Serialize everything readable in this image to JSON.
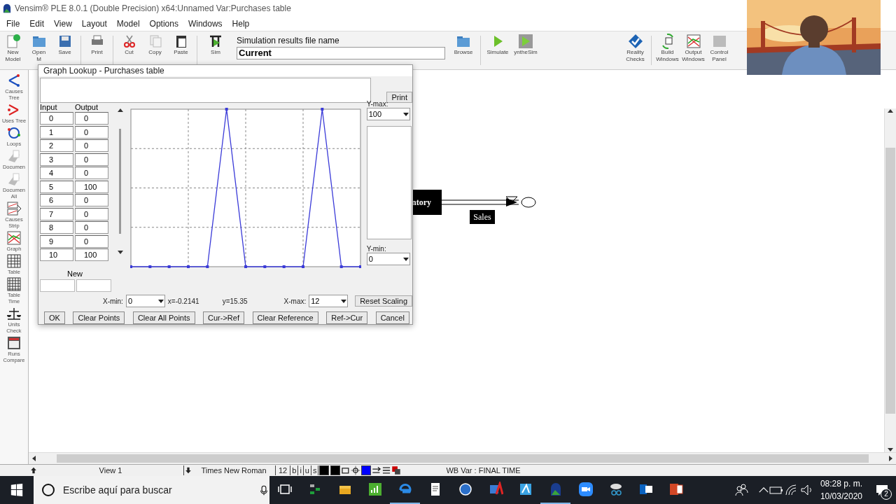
{
  "window": {
    "title": "Vensim® PLE 8.0.1 (Double Precision) x64:Unnamed Var:Purchases table"
  },
  "menu": [
    "File",
    "Edit",
    "View",
    "Layout",
    "Model",
    "Options",
    "Windows",
    "Help"
  ],
  "toolbar": {
    "left": [
      {
        "lines": [
          "New",
          "Model"
        ]
      },
      {
        "lines": [
          "Open",
          "M"
        ]
      },
      {
        "lines": [
          "Save"
        ]
      },
      {
        "lines": [
          "Print"
        ]
      },
      {
        "lines": [
          "Cut"
        ]
      },
      {
        "lines": [
          "Copy"
        ]
      },
      {
        "lines": [
          "Paste"
        ]
      },
      {
        "lines": [
          "Sim"
        ]
      }
    ],
    "results_file": {
      "label": "Simulation results file name",
      "value": "Current"
    },
    "right": [
      {
        "lines": [
          "Browse"
        ]
      },
      {
        "lines": [
          "Simulate"
        ]
      },
      {
        "lines": [
          "yntheSim"
        ]
      },
      {
        "lines": [
          "Reality",
          "Checks"
        ]
      },
      {
        "lines": [
          "Build",
          "Windows"
        ]
      },
      {
        "lines": [
          "Output",
          "Windows"
        ]
      },
      {
        "lines": [
          "Control",
          "Panel"
        ]
      }
    ]
  },
  "sidebar": {
    "items": [
      {
        "lines": [
          "Causes",
          "Tree"
        ]
      },
      {
        "lines": [
          "Uses Tree"
        ]
      },
      {
        "lines": [
          "Loops"
        ]
      },
      {
        "lines": [
          "Documen"
        ]
      },
      {
        "lines": [
          "Documen",
          "All"
        ]
      },
      {
        "lines": [
          "Causes",
          "Strip"
        ]
      },
      {
        "lines": [
          "Graph"
        ]
      },
      {
        "lines": [
          "Table"
        ]
      },
      {
        "lines": [
          "Table",
          "Time"
        ]
      },
      {
        "lines": [
          "Units",
          "Check"
        ]
      },
      {
        "lines": [
          "Runs",
          "Compare"
        ]
      }
    ]
  },
  "diagram": {
    "stock": "ntory",
    "flow": "Sales"
  },
  "dialog": {
    "title": "Graph Lookup - Purchases table",
    "print": "Print",
    "columns": [
      "Input",
      "Output"
    ],
    "rows": [
      [
        "0",
        "0"
      ],
      [
        "1",
        "0"
      ],
      [
        "2",
        "0"
      ],
      [
        "3",
        "0"
      ],
      [
        "4",
        "0"
      ],
      [
        "5",
        "100"
      ],
      [
        "6",
        "0"
      ],
      [
        "7",
        "0"
      ],
      [
        "8",
        "0"
      ],
      [
        "9",
        "0"
      ],
      [
        "10",
        "100"
      ]
    ],
    "new_label": "New",
    "ymax_label": "Y-max:",
    "ymax": "100",
    "ymin_label": "Y-min:",
    "ymin": "0",
    "xmin_label": "X-min:",
    "xmin": "0",
    "x_readout": "x=-0.2141",
    "y_readout": "y=15.35",
    "xmax_label": "X-max:",
    "xmax": "12",
    "reset": "Reset Scaling",
    "buttons": [
      "OK",
      "Clear Points",
      "Clear All Points",
      "Cur->Ref",
      "Clear Reference",
      "Ref->Cur",
      "Cancel"
    ]
  },
  "status_bar": {
    "view": "View 1",
    "font": "Times New Roman",
    "size": "12",
    "styles": [
      "b",
      "i",
      "u",
      "s"
    ],
    "message": "WB Var : FINAL TIME"
  },
  "taskbar": {
    "search_placeholder": "Escribe aquí para buscar",
    "time": "08:28 p. m.",
    "date": "10/03/2020",
    "notifications": "2"
  }
}
